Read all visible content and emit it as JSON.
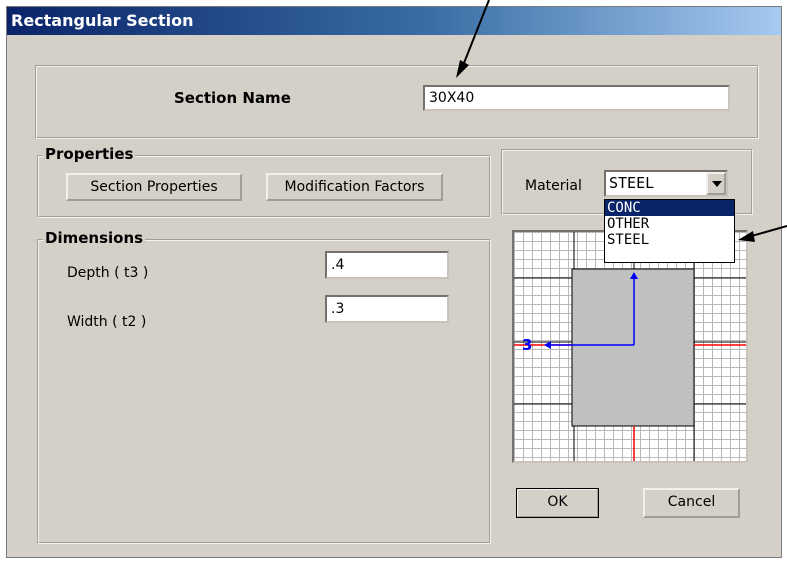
{
  "dialog": {
    "title": "Rectangular Section",
    "section_name_label": "Section Name",
    "section_name_value": "30X40",
    "properties": {
      "legend": "Properties",
      "section_properties_button": "Section Properties",
      "modification_factors_button": "Modification Factors"
    },
    "material": {
      "label": "Material",
      "selected": "STEEL",
      "options": [
        "CONC",
        "OTHER",
        "STEEL"
      ],
      "highlighted_option": "CONC"
    },
    "dimensions": {
      "legend": "Dimensions",
      "depth_label": "Depth  ( t3 )",
      "depth_value": ".4",
      "width_label": "Width  ( t2 )",
      "width_value": ".3"
    },
    "preview": {
      "axis_label": "3",
      "axis_color": "#0000ff",
      "section_fill": "#c0c0c0",
      "centerline_color": "#ff0000"
    },
    "ok_button": "OK",
    "cancel_button": "Cancel"
  }
}
